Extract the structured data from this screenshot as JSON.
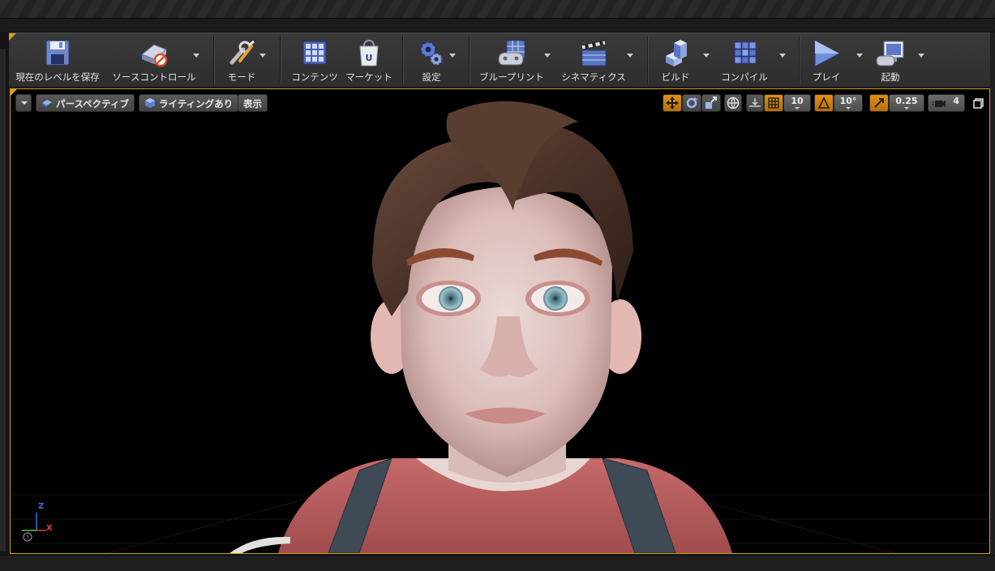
{
  "toolbar": {
    "save_label": "現在のレベルを保存",
    "source_control_label": "ソースコントロール",
    "modes_label": "モード",
    "content_label": "コンテンツ",
    "marketplace_label": "マーケット",
    "settings_label": "設定",
    "blueprints_label": "ブループリント",
    "cinematics_label": "シネマティクス",
    "build_label": "ビルド",
    "compile_label": "コンパイル",
    "play_label": "プレイ",
    "launch_label": "起動"
  },
  "viewport": {
    "perspective_label": "パースペクティブ",
    "lighting_label": "ライティングあり",
    "show_label": "表示",
    "grid_snap_value": "10",
    "rotation_snap_value": "10°",
    "scale_snap_value": "0.25",
    "camera_speed_value": "4",
    "axis_z": "Z",
    "axis_x": "X"
  },
  "colors": {
    "accent": "#d9a01a",
    "toolbar_bg": "#333333",
    "viewport_bg": "#000000",
    "active_toggle": "#d0820c"
  },
  "icons": [
    "save-icon",
    "source-control-icon",
    "modes-icon",
    "content-icon",
    "marketplace-icon",
    "settings-icon",
    "blueprints-icon",
    "cinematics-icon",
    "build-icon",
    "compile-icon",
    "play-icon",
    "launch-icon"
  ]
}
